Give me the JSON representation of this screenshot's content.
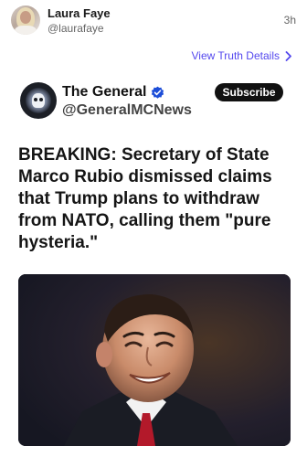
{
  "post": {
    "author_name": "Laura Faye",
    "author_handle": "@laurafaye",
    "timestamp": "3h",
    "view_details_label": "View Truth Details"
  },
  "embed": {
    "name": "The General",
    "handle": "@GeneralMCNews",
    "subscribe_label": "Subscribe",
    "headline": "BREAKING: Secretary of State Marco Rubio dismissed claims that Trump plans to withdraw from NATO, calling them \"pure hysteria.\"",
    "image_description_icon": "news-photo"
  },
  "colors": {
    "accent": "#5448ee",
    "verified": "#1d4ed8",
    "button_bg": "#111111"
  }
}
